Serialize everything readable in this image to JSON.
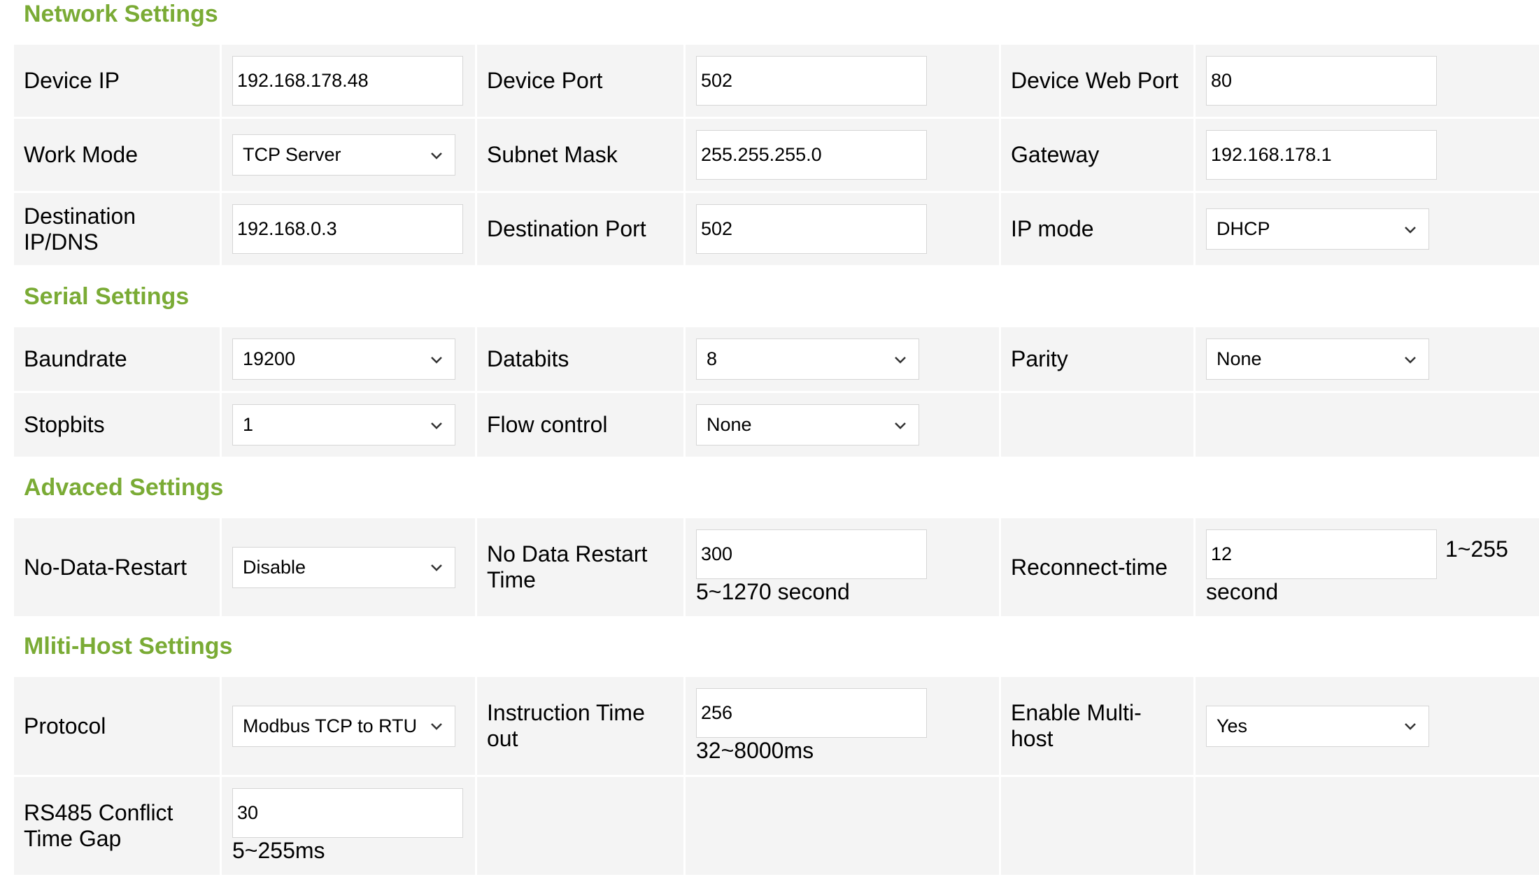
{
  "sections": {
    "network": {
      "title": "Network Settings",
      "device_ip": {
        "label": "Device IP",
        "value": "192.168.178.48"
      },
      "device_port": {
        "label": "Device Port",
        "value": "502"
      },
      "device_web_port": {
        "label": "Device Web Port",
        "value": "80"
      },
      "work_mode": {
        "label": "Work Mode",
        "selected": "TCP Server"
      },
      "subnet_mask": {
        "label": "Subnet Mask",
        "value": "255.255.255.0"
      },
      "gateway": {
        "label": "Gateway",
        "value": "192.168.178.1"
      },
      "destination_ip": {
        "label_line1": "Destination",
        "label_line2": "IP/DNS",
        "value": "192.168.0.3"
      },
      "destination_port": {
        "label": "Destination Port",
        "value": "502"
      },
      "ip_mode": {
        "label": "IP mode",
        "selected": "DHCP"
      }
    },
    "serial": {
      "title": "Serial Settings",
      "baudrate": {
        "label": "Baundrate",
        "selected": "19200"
      },
      "databits": {
        "label": "Databits",
        "selected": "8"
      },
      "parity": {
        "label": "Parity",
        "selected": "None"
      },
      "stopbits": {
        "label": "Stopbits",
        "selected": "1"
      },
      "flow_control": {
        "label": "Flow control",
        "selected": "None"
      }
    },
    "advanced": {
      "title": "Advaced Settings",
      "no_data_restart": {
        "label": "No-Data-Restart",
        "selected": "Disable"
      },
      "no_data_restart_time": {
        "label_line1": "No Data Restart",
        "label_line2": "Time",
        "value": "300",
        "hint": "5~1270 second"
      },
      "reconnect_time": {
        "label": "Reconnect-time",
        "value": "12",
        "hint_right": "1~255",
        "hint_below": "second"
      }
    },
    "multihost": {
      "title": "Mliti-Host Settings",
      "protocol": {
        "label": "Protocol",
        "selected": "Modbus TCP to RTU"
      },
      "instruction_timeout": {
        "label_line1": "Instruction Time",
        "label_line2": "out",
        "value": "256",
        "hint": "32~8000ms"
      },
      "enable_multihost": {
        "label_line1": "Enable Multi-",
        "label_line2": "host",
        "selected": "Yes"
      },
      "rs485_gap": {
        "label_line1": "RS485 Conflict",
        "label_line2": "Time Gap",
        "value": "30",
        "hint": "5~255ms"
      }
    }
  },
  "icons": {
    "dropdown": "chevron-down-icon"
  },
  "colors": {
    "section_title": "#7aab35",
    "cell_bg": "#f4f4f4"
  }
}
